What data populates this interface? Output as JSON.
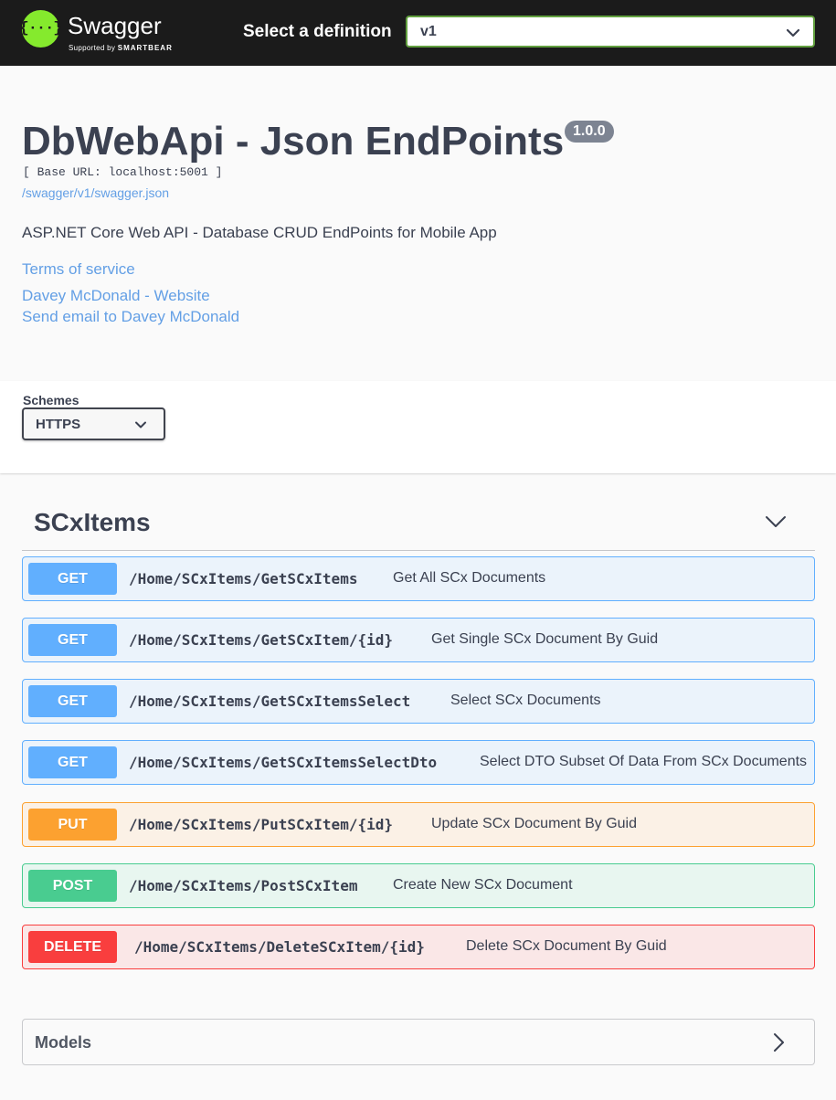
{
  "topbar": {
    "brand_name": "Swagger",
    "brand_supported": "Supported by",
    "brand_company": "SMARTBEAR",
    "select_definition_label": "Select a definition",
    "selected_definition": "v1"
  },
  "info": {
    "title": "DbWebApi - Json EndPoints",
    "version": "1.0.0",
    "base_url": "[ Base URL: localhost:5001 ]",
    "spec_url": "/swagger/v1/swagger.json",
    "description": "ASP.NET Core Web API - Database CRUD EndPoints for Mobile App",
    "terms_link": "Terms of service",
    "website_link": "Davey McDonald - Website",
    "email_link": "Send email to Davey McDonald"
  },
  "schemes": {
    "label": "Schemes",
    "selected": "HTTPS"
  },
  "tag": {
    "name": "SCxItems",
    "operations": [
      {
        "method": "GET",
        "path": "/Home/SCxItems/GetSCxItems",
        "summary": "Get All SCx Documents"
      },
      {
        "method": "GET",
        "path": "/Home/SCxItems/GetSCxItem/{id}",
        "summary": "Get Single SCx Document By Guid"
      },
      {
        "method": "GET",
        "path": "/Home/SCxItems/GetSCxItemsSelect",
        "summary": "Select SCx Documents"
      },
      {
        "method": "GET",
        "path": "/Home/SCxItems/GetSCxItemsSelectDto",
        "summary": "Select DTO Subset Of Data From SCx Documents"
      },
      {
        "method": "PUT",
        "path": "/Home/SCxItems/PutSCxItem/{id}",
        "summary": "Update SCx Document By Guid"
      },
      {
        "method": "POST",
        "path": "/Home/SCxItems/PostSCxItem",
        "summary": "Create New SCx Document"
      },
      {
        "method": "DELETE",
        "path": "/Home/SCxItems/DeleteSCxItem/{id}",
        "summary": "Delete SCx Document By Guid"
      }
    ]
  },
  "models": {
    "label": "Models"
  },
  "colors": {
    "get": "#61affe",
    "put": "#fca130",
    "post": "#49cc90",
    "delete": "#f93e3e",
    "logo": "#85ea2d",
    "topbar": "#1b1b1b"
  },
  "icons": {
    "logo": "swagger-braces-icon",
    "definition_dropdown": "chevron-down-icon",
    "schemes_dropdown": "chevron-down-icon",
    "tag_toggle": "chevron-down-icon",
    "models_toggle": "chevron-right-icon"
  }
}
